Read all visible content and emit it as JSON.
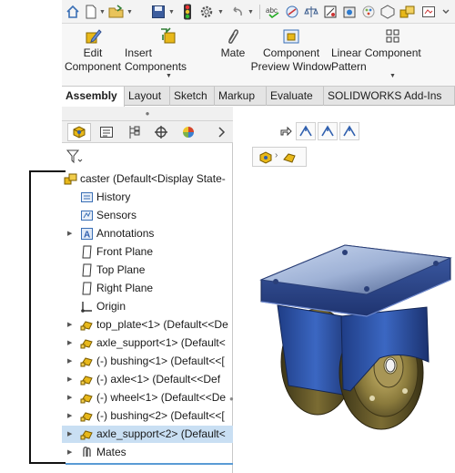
{
  "ribbon": {
    "edit_component": "Edit\nComponent",
    "insert_components": "Insert Components",
    "mate": "Mate",
    "component_preview_window": "Component\nPreview Window",
    "linear_component_pattern": "Linear Component Pattern"
  },
  "tabs": [
    {
      "label": "Assembly",
      "active": true
    },
    {
      "label": "Layout",
      "active": false
    },
    {
      "label": "Sketch",
      "active": false
    },
    {
      "label": "Markup",
      "active": false
    },
    {
      "label": "Evaluate",
      "active": false
    },
    {
      "label": "SOLIDWORKS Add-Ins",
      "active": false
    }
  ],
  "pane_tabs": [
    "featuremanager-icon",
    "propertymanager-icon",
    "configurationmanager-icon",
    "dimxpertmanager-icon",
    "displaymanager-icon",
    "chevron-right-icon"
  ],
  "tree": {
    "root": "caster  (Default<Display State-",
    "items": [
      {
        "label": "History",
        "icon": "history-icon",
        "expander": false
      },
      {
        "label": "Sensors",
        "icon": "sensors-icon",
        "expander": false
      },
      {
        "label": "Annotations",
        "icon": "annotations-icon",
        "expander": true
      },
      {
        "label": "Front Plane",
        "icon": "plane-icon",
        "expander": false
      },
      {
        "label": "Top Plane",
        "icon": "plane-icon",
        "expander": false
      },
      {
        "label": "Right Plane",
        "icon": "plane-icon",
        "expander": false
      },
      {
        "label": "Origin",
        "icon": "origin-icon",
        "expander": false
      },
      {
        "label": "top_plate<1> (Default<<De",
        "icon": "part-icon",
        "expander": true
      },
      {
        "label": "axle_support<1> (Default<",
        "icon": "part-icon",
        "expander": true
      },
      {
        "label": "(-) bushing<1> (Default<<[",
        "icon": "part-icon",
        "expander": true
      },
      {
        "label": "(-) axle<1> (Default<<Def",
        "icon": "part-icon",
        "expander": true
      },
      {
        "label": "(-) wheel<1> (Default<<De",
        "icon": "part-icon",
        "expander": true
      },
      {
        "label": "(-) bushing<2> (Default<<[",
        "icon": "part-icon",
        "expander": true
      },
      {
        "label": "axle_support<2> (Default<",
        "icon": "part-icon",
        "expander": true,
        "selected": true
      },
      {
        "label": "Mates",
        "icon": "mates-icon",
        "expander": true
      }
    ]
  },
  "colors": {
    "selection": "#c9dff3",
    "part_yellow": "#e8b81a",
    "caster_blue": "#2f5fae",
    "wheel_olive": "#8a7a3c"
  }
}
